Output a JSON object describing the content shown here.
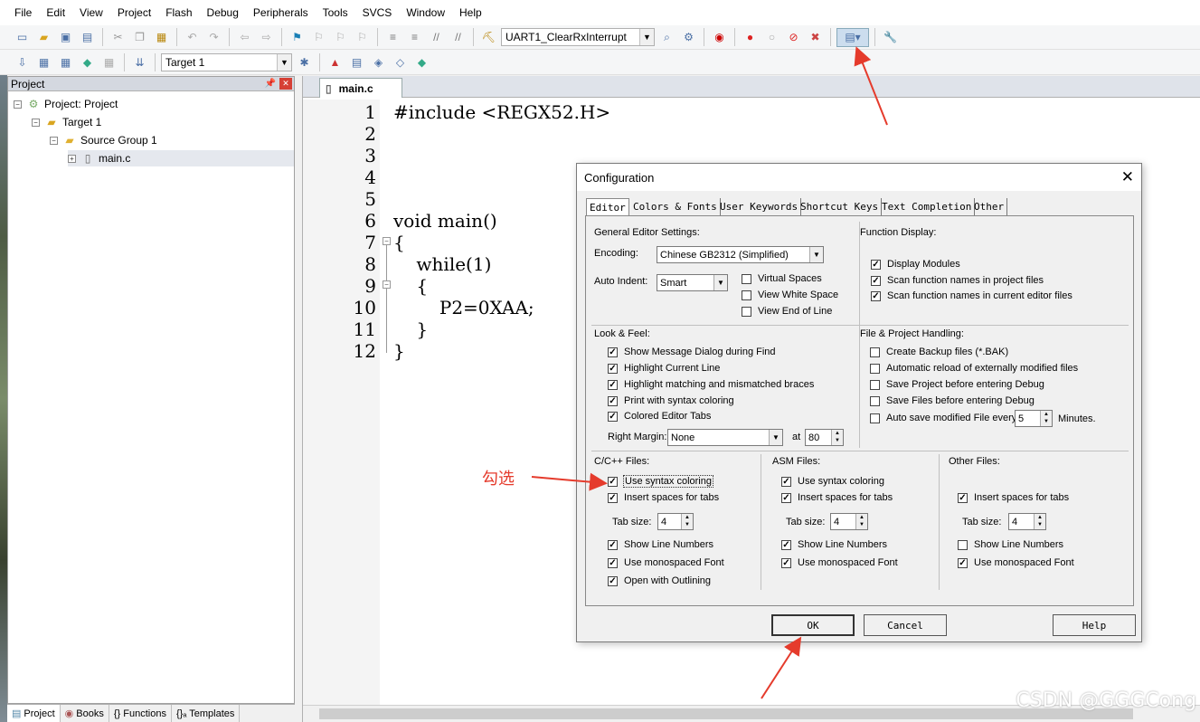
{
  "menu": [
    "File",
    "Edit",
    "View",
    "Project",
    "Flash",
    "Debug",
    "Peripherals",
    "Tools",
    "SVCS",
    "Window",
    "Help"
  ],
  "toolbar": {
    "function_combo": "UART1_ClearRxInterrupt",
    "target_combo": "Target 1"
  },
  "project_panel": {
    "title": "Project",
    "pin_icon": "pin-icon",
    "tree": [
      {
        "label": "Project: Project",
        "expander": "−"
      },
      {
        "label": "Target 1",
        "expander": "−"
      },
      {
        "label": "Source Group 1",
        "expander": "−"
      },
      {
        "label": "main.c",
        "expander": "+"
      }
    ],
    "bottom_tabs": [
      "Project",
      "Books",
      "{} Functions",
      "{}ₐ Templates"
    ]
  },
  "editor": {
    "tab": "main.c",
    "line_numbers": [
      "1",
      "2",
      "3",
      "4",
      "5",
      "6",
      "7",
      "8",
      "9",
      "10",
      "11",
      "12"
    ],
    "lines": [
      "#include <REGX52.H>",
      "",
      "",
      "",
      "",
      "void main()",
      "{",
      "    while(1)",
      "    {",
      "        P2=0XAA;",
      "    }",
      "}"
    ],
    "fold_markers": [
      "−",
      "−"
    ]
  },
  "dialog": {
    "title": "Configuration",
    "close": "✕",
    "tabs": [
      "Editor",
      "Colors & Fonts",
      "User Keywords",
      "Shortcut Keys",
      "Text Completion",
      "Other"
    ],
    "general": {
      "heading": "General Editor Settings:",
      "encoding_label": "Encoding:",
      "encoding_value": "Chinese GB2312 (Simplified)",
      "auto_indent_label": "Auto Indent:",
      "auto_indent_value": "Smart",
      "virtual_spaces": "Virtual Spaces",
      "view_white_space": "View White Space",
      "view_end_of_line": "View End of Line"
    },
    "function_display": {
      "heading": "Function Display:",
      "display_modules": "Display Modules",
      "scan_project": "Scan function names in project files",
      "scan_editor": "Scan function names in current editor files"
    },
    "look_feel": {
      "heading": "Look & Feel:",
      "show_message": "Show Message Dialog during Find",
      "highlight_line": "Highlight Current Line",
      "highlight_braces": "Highlight matching and mismatched braces",
      "print_syntax": "Print with syntax coloring",
      "colored_tabs": "Colored Editor Tabs",
      "right_margin_label": "Right Margin:",
      "right_margin_value": "None",
      "at_label": "at",
      "at_value": "80"
    },
    "file_handling": {
      "heading": "File & Project Handling:",
      "backup": "Create Backup files (*.BAK)",
      "auto_reload": "Automatic reload of externally modified files",
      "save_project": "Save Project before entering Debug",
      "save_files": "Save Files before entering Debug",
      "auto_save": "Auto save modified File every",
      "auto_save_value": "5",
      "minutes": "Minutes."
    },
    "c_files": {
      "heading": "C/C++ Files:",
      "syntax": "Use syntax coloring",
      "insert_spaces": "Insert spaces for tabs",
      "tab_size_label": "Tab size:",
      "tab_size": "4",
      "line_numbers": "Show Line Numbers",
      "mono": "Use monospaced Font",
      "outlining": "Open with Outlining"
    },
    "asm_files": {
      "heading": "ASM Files:",
      "syntax": "Use syntax coloring",
      "insert_spaces": "Insert spaces for tabs",
      "tab_size_label": "Tab size:",
      "tab_size": "4",
      "line_numbers": "Show Line Numbers",
      "mono": "Use monospaced Font"
    },
    "other_files": {
      "heading": "Other Files:",
      "insert_spaces": "Insert spaces for tabs",
      "tab_size_label": "Tab size:",
      "tab_size": "4",
      "line_numbers": "Show Line Numbers",
      "mono": "Use monospaced Font"
    },
    "buttons": {
      "ok": "OK",
      "cancel": "Cancel",
      "help": "Help"
    }
  },
  "annotation": {
    "text": "勾选",
    "color": "#e53b2c"
  },
  "watermark": "CSDN @GGGCong",
  "checked_mark": "✓"
}
